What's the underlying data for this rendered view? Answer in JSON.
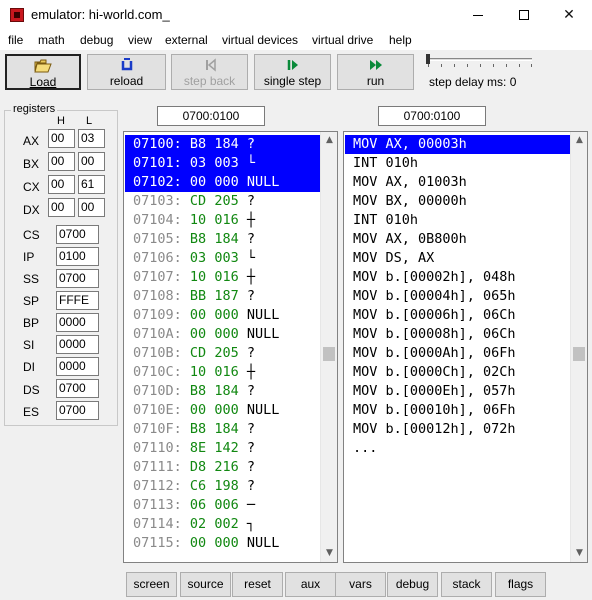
{
  "window": {
    "title": "emulator: hi-world.com_"
  },
  "menu": [
    "file",
    "math",
    "debug",
    "view",
    "external",
    "virtual devices",
    "virtual drive",
    "help"
  ],
  "toolbar": {
    "load": "Load",
    "reload": "reload",
    "step_back": "step back",
    "single_step": "single step",
    "run": "run",
    "step_delay": "step delay ms: 0",
    "step_delay_ms": 0
  },
  "registers": {
    "title": "registers",
    "h_label": "H",
    "l_label": "L",
    "split": [
      {
        "name": "AX",
        "h": "00",
        "l": "03"
      },
      {
        "name": "BX",
        "h": "00",
        "l": "00"
      },
      {
        "name": "CX",
        "h": "00",
        "l": "61"
      },
      {
        "name": "DX",
        "h": "00",
        "l": "00"
      }
    ],
    "full": [
      {
        "name": "CS",
        "value": "0700"
      },
      {
        "name": "IP",
        "value": "0100"
      },
      {
        "name": "SS",
        "value": "0700"
      },
      {
        "name": "SP",
        "value": "FFFE"
      },
      {
        "name": "BP",
        "value": "0000"
      },
      {
        "name": "SI",
        "value": "0000"
      },
      {
        "name": "DI",
        "value": "0000"
      },
      {
        "name": "DS",
        "value": "0700"
      },
      {
        "name": "ES",
        "value": "0700"
      }
    ]
  },
  "memory": {
    "address": "0700:0100",
    "selected_rows": 3,
    "rows": [
      {
        "addr": "07100:",
        "hex": "B8",
        "dec": "184",
        "chr": "?"
      },
      {
        "addr": "07101:",
        "hex": "03",
        "dec": "003",
        "chr": "└"
      },
      {
        "addr": "07102:",
        "hex": "00",
        "dec": "000",
        "chr": "NULL"
      },
      {
        "addr": "07103:",
        "hex": "CD",
        "dec": "205",
        "chr": "?"
      },
      {
        "addr": "07104:",
        "hex": "10",
        "dec": "016",
        "chr": "┼"
      },
      {
        "addr": "07105:",
        "hex": "B8",
        "dec": "184",
        "chr": "?"
      },
      {
        "addr": "07106:",
        "hex": "03",
        "dec": "003",
        "chr": "└"
      },
      {
        "addr": "07107:",
        "hex": "10",
        "dec": "016",
        "chr": "┼"
      },
      {
        "addr": "07108:",
        "hex": "BB",
        "dec": "187",
        "chr": "?"
      },
      {
        "addr": "07109:",
        "hex": "00",
        "dec": "000",
        "chr": "NULL"
      },
      {
        "addr": "0710A:",
        "hex": "00",
        "dec": "000",
        "chr": "NULL"
      },
      {
        "addr": "0710B:",
        "hex": "CD",
        "dec": "205",
        "chr": "?"
      },
      {
        "addr": "0710C:",
        "hex": "10",
        "dec": "016",
        "chr": "┼"
      },
      {
        "addr": "0710D:",
        "hex": "B8",
        "dec": "184",
        "chr": "?"
      },
      {
        "addr": "0710E:",
        "hex": "00",
        "dec": "000",
        "chr": "NULL"
      },
      {
        "addr": "0710F:",
        "hex": "B8",
        "dec": "184",
        "chr": "?"
      },
      {
        "addr": "07110:",
        "hex": "8E",
        "dec": "142",
        "chr": "?"
      },
      {
        "addr": "07111:",
        "hex": "D8",
        "dec": "216",
        "chr": "?"
      },
      {
        "addr": "07112:",
        "hex": "C6",
        "dec": "198",
        "chr": "?"
      },
      {
        "addr": "07113:",
        "hex": "06",
        "dec": "006",
        "chr": "─"
      },
      {
        "addr": "07114:",
        "hex": "02",
        "dec": "002",
        "chr": "┐"
      },
      {
        "addr": "07115:",
        "hex": "00",
        "dec": "000",
        "chr": "NULL"
      }
    ]
  },
  "disassembly": {
    "address": "0700:0100",
    "selected_rows": 1,
    "lines": [
      "MOV AX, 00003h",
      "INT 010h",
      "MOV AX, 01003h",
      "MOV BX, 00000h",
      "INT 010h",
      "MOV AX, 0B800h",
      "MOV DS, AX",
      "MOV b.[00002h], 048h",
      "MOV b.[00004h], 065h",
      "MOV b.[00006h], 06Ch",
      "MOV b.[00008h], 06Ch",
      "MOV b.[0000Ah], 06Fh",
      "MOV b.[0000Ch], 02Ch",
      "MOV b.[0000Eh], 057h",
      "MOV b.[00010h], 06Fh",
      "MOV b.[00012h], 072h",
      "..."
    ]
  },
  "bottom_buttons": [
    "screen",
    "source",
    "reset",
    "aux",
    "vars",
    "debug",
    "stack",
    "flags"
  ],
  "colors": {
    "selection": "#0000ff",
    "hex_value": "#118811",
    "address": "#8a8a8a"
  },
  "icons": {
    "load": "open-folder-icon",
    "reload": "reload-icon",
    "step_back": "step-back-icon",
    "single_step": "single-step-icon",
    "run": "run-icon"
  }
}
